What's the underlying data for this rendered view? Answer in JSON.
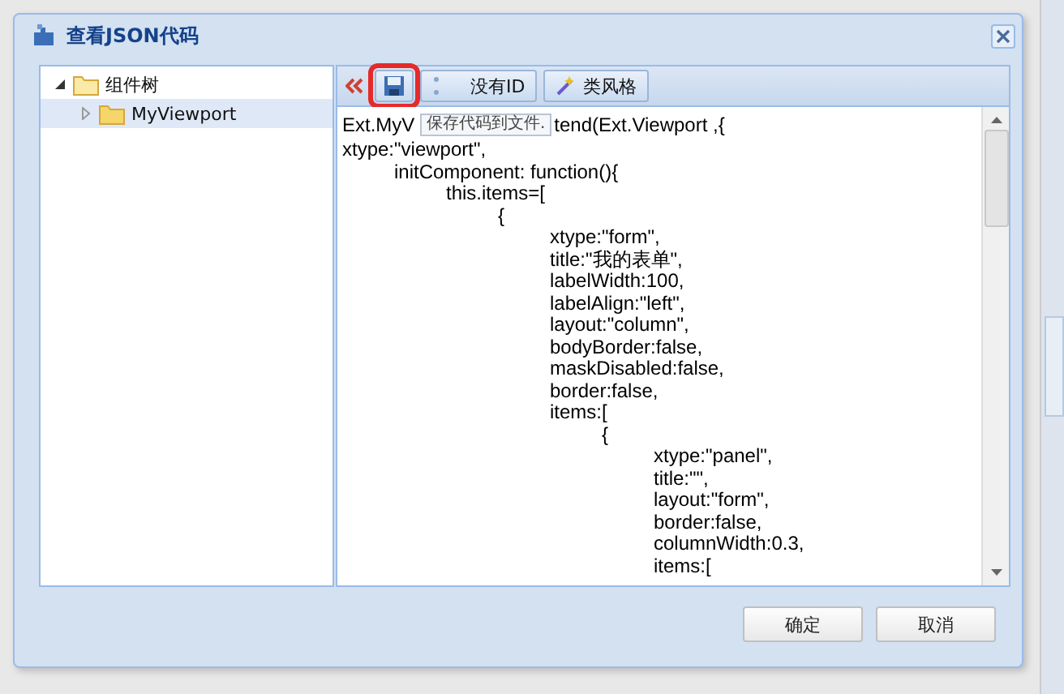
{
  "window": {
    "title": "查看JSON代码"
  },
  "tree": [
    {
      "label": "组件树",
      "expanded": true,
      "selected": false,
      "children": [
        {
          "label": "MyViewport",
          "expanded": false,
          "selected": true
        }
      ]
    }
  ],
  "toolbar": [
    {
      "kind": "collapse"
    },
    {
      "kind": "save",
      "highlighted": true
    },
    {
      "kind": "noid",
      "label": "没有ID"
    },
    {
      "kind": "style",
      "label": "类风格"
    }
  ],
  "tooltip": "保存代码到文件.",
  "code": {
    "first_line": [
      "Ext.MyV",
      "tend(Ext.Viewport ,{"
    ],
    "lines": [
      "xtype:\"viewport\",",
      "\tinitComponent: function(){",
      "\t\tthis.items=[",
      "\t\t\t{",
      "\t\t\t\txtype:\"form\",",
      "\t\t\t\ttitle:\"我的表单\",",
      "\t\t\t\tlabelWidth:100,",
      "\t\t\t\tlabelAlign:\"left\",",
      "\t\t\t\tlayout:\"column\",",
      "\t\t\t\tbodyBorder:false,",
      "\t\t\t\tmaskDisabled:false,",
      "\t\t\t\tborder:false,",
      "\t\t\t\titems:[",
      "\t\t\t\t\t{",
      "\t\t\t\t\t\txtype:\"panel\",",
      "\t\t\t\t\t\ttitle:\"\",",
      "\t\t\t\t\t\tlayout:\"form\",",
      "\t\t\t\t\t\tborder:false,",
      "\t\t\t\t\t\tcolumnWidth:0.3,",
      "\t\t\t\t\t\titems:["
    ]
  },
  "buttons": [
    "确定",
    "取消"
  ]
}
